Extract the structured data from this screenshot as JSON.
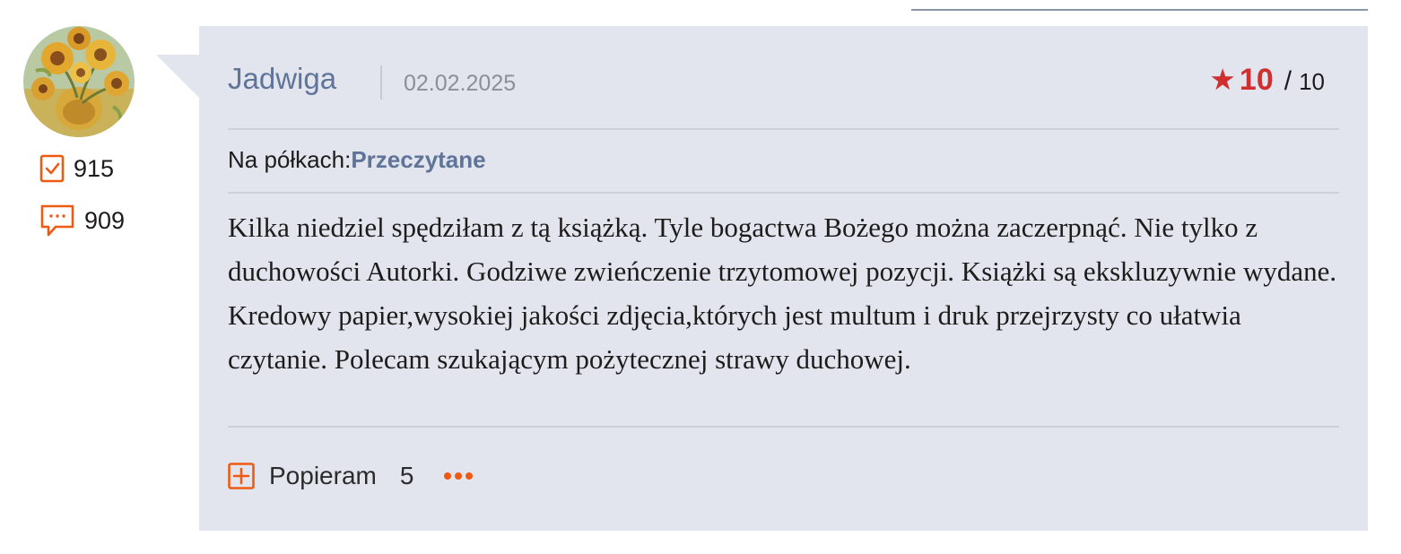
{
  "stats": {
    "read_count": "915",
    "comments_count": "909"
  },
  "review": {
    "author": "Jadwiga",
    "date": "02.02.2025",
    "rating": {
      "score": "10",
      "slash": "/",
      "max": "10"
    },
    "shelf_label": "Na półkach:",
    "shelf_value": "Przeczytane",
    "text": "Kilka niedziel spędziłam z tą książką. Tyle bogactwa Bożego można zaczerpnąć. Nie tylko z duchowości Autorki. Godziwe zwieńczenie trzytomowej pozycji. Książki są ekskluzywnie wydane. Kredowy papier,wysokiej jakości zdjęcia,których jest multum i druk przejrzysty co ułatwia czytanie. Polecam szukającym pożytecznej strawy duchowej.",
    "support_label": "Popieram",
    "support_count": "5"
  },
  "icons": {
    "read": "checkbox-check-icon",
    "comments": "speech-bubble-icon",
    "support": "plus-square-icon",
    "more": "more-dots-icon",
    "rating": "star-icon"
  },
  "colors": {
    "accent_orange": "#ef5a12",
    "rating_red": "#cf2f2f",
    "link_blue": "#5f7498",
    "card_bg": "#e2e5ee"
  }
}
